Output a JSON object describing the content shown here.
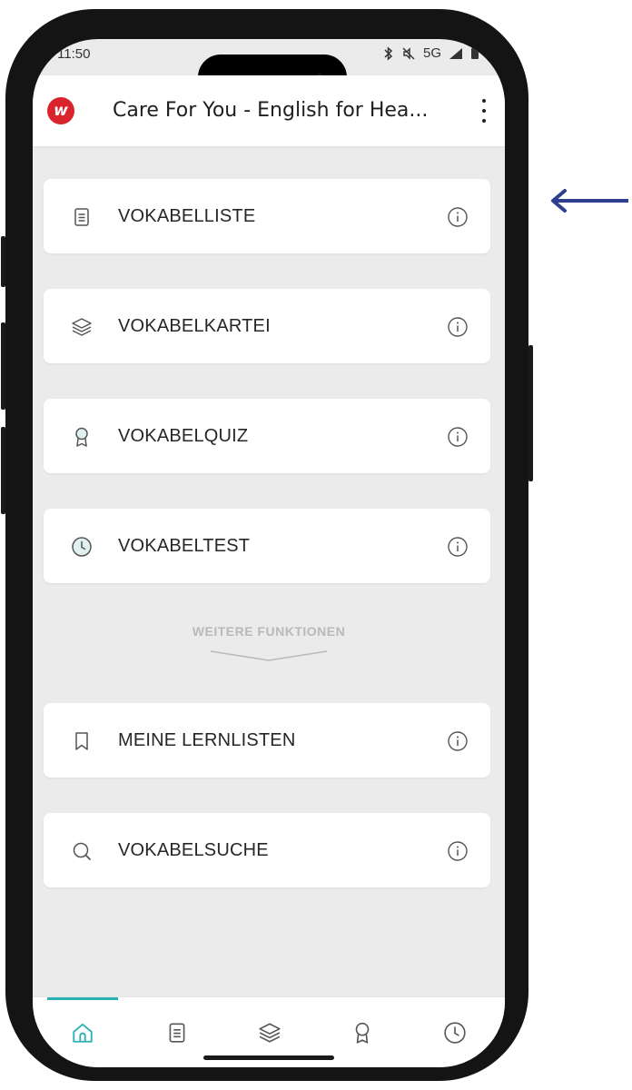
{
  "status_bar": {
    "time": "11:50",
    "network": "5G"
  },
  "app_bar": {
    "logo_letter": "w",
    "title": "Care For You - English for Hea..."
  },
  "cards": [
    {
      "label": "VOKABELLISTE",
      "icon": "list-icon"
    },
    {
      "label": "VOKABELKARTEI",
      "icon": "layers-icon"
    },
    {
      "label": "VOKABELQUIZ",
      "icon": "award-icon"
    },
    {
      "label": "VOKABELTEST",
      "icon": "clock-icon"
    },
    {
      "label": "MEINE LERNLISTEN",
      "icon": "bookmark-icon"
    },
    {
      "label": "VOKABELSUCHE",
      "icon": "search-icon"
    }
  ],
  "section_divider": "WEITERE FUNKTIONEN",
  "bottom_nav": {
    "active_index": 0,
    "items": [
      "home-icon",
      "list-icon",
      "layers-icon",
      "award-icon",
      "clock-icon"
    ]
  },
  "colors": {
    "accent": "#2ab1b6",
    "brand": "#d9232d",
    "annotation_arrow": "#2e3f8f",
    "background": "#ebebeb"
  }
}
